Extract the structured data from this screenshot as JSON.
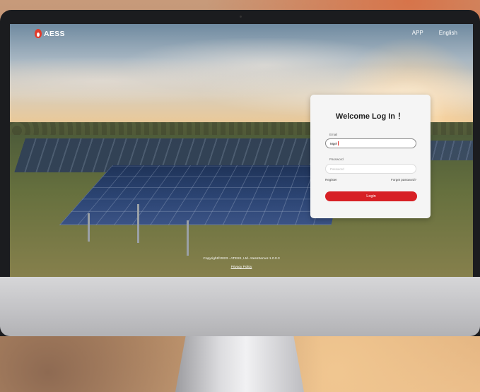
{
  "header": {
    "logo_text": "AESS",
    "nav": [
      "APP",
      "English"
    ]
  },
  "login": {
    "title": "Welcome Log In ！",
    "email_label": "Email",
    "email_value": "Mgel",
    "password_label": "Password",
    "password_placeholder": "Password",
    "register_label": "Register",
    "forgot_label": "Forget password?",
    "login_button": "Login"
  },
  "footer": {
    "copyright": "Copyright©2023 - ATESS, Ltd. AtessServer-1.0.0.3",
    "privacy": "Privacy Policy"
  },
  "colors": {
    "brand_red": "#d72025",
    "logo_red": "#e23a2a"
  },
  "icons": {
    "logo": "flame-logo-icon"
  }
}
